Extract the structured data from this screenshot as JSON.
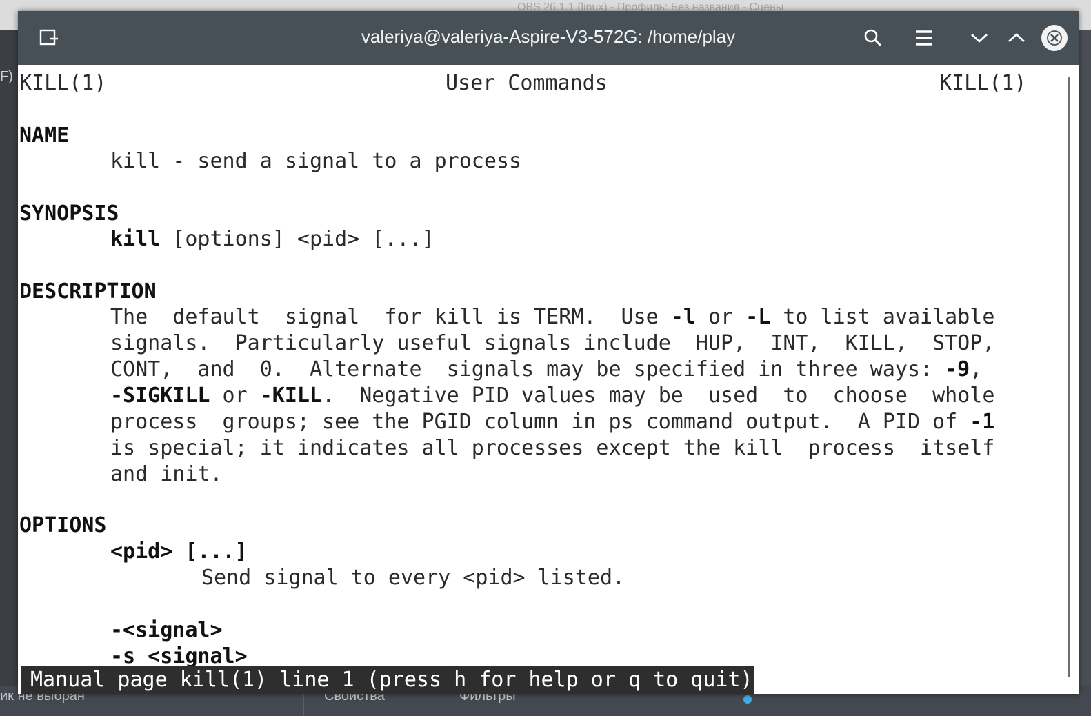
{
  "background": {
    "top_right_text": "OBS 26.1.1 (linux) - Профиль: Без названия - Сцены",
    "left_edge_glyph": "F)",
    "taskbar_left_text": "ик не выбран",
    "taskbar_props": "Свойства",
    "taskbar_filters": "Фильтры"
  },
  "window": {
    "title": "valeriya@valeriya-Aspire-V3-572G: /home/play",
    "icons": [
      "new-tab-icon",
      "search-icon",
      "menu-icon",
      "chevron-down-icon",
      "chevron-up-icon",
      "close-icon"
    ]
  },
  "man": {
    "header_left": "KILL(1)",
    "header_center": "User Commands",
    "header_right": "KILL(1)",
    "name_heading": "NAME",
    "name_text": "kill - send a signal to a process",
    "synopsis_heading": "SYNOPSIS",
    "synopsis_cmd": "kill",
    "synopsis_args": " [options] <pid> [...]",
    "description_heading": "DESCRIPTION",
    "desc_l1_a": "The  default  signal  for kill is TERM.  Use ",
    "desc_l1_b": "-l",
    "desc_l1_c": " or ",
    "desc_l1_d": "-L",
    "desc_l1_e": " to list available",
    "desc_l2": "signals.  Particularly useful signals include  HUP,  INT,  KILL,  STOP,",
    "desc_l3_a": "CONT,  and  0.  Alternate  signals may be specified in three ways: ",
    "desc_l3_b": "-9",
    "desc_l3_c": ",",
    "desc_l4_a": "-SIGKILL",
    "desc_l4_b": " or ",
    "desc_l4_c": "-KILL",
    "desc_l4_d": ".  Negative PID values may be  used  to  choose  whole",
    "desc_l5_a": "process  groups; see the PGID column in ps command output.  A PID of ",
    "desc_l5_b": "-1",
    "desc_l6": "is special; it indicates all processes except the kill  process  itself",
    "desc_l7": "and init.",
    "options_heading": "OPTIONS",
    "opt1_name": "<pid> [...]",
    "opt1_desc": "Send signal to every <pid> listed.",
    "opt2_name": "-<signal>",
    "opt3_name": "-s <signal>"
  },
  "status_line": "Manual page kill(1) line 1 (press h for help or q to quit)"
}
